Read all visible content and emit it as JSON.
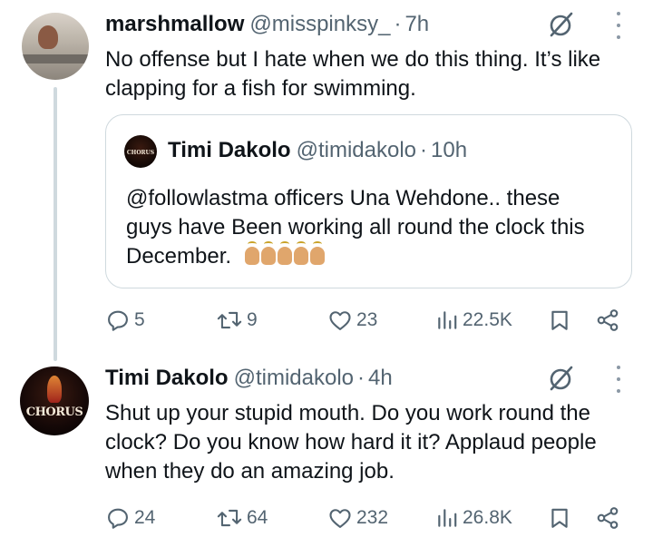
{
  "post1": {
    "display_name": "marshmallow",
    "handle": "@misspinksy_",
    "separator": "·",
    "time": "7h",
    "text_line1": "No offense but I hate when we do this thing. It’s like",
    "text_line2": "clapping for a fish for swimming.",
    "quote": {
      "display_name": "Timi Dakolo",
      "handle": "@timidakolo",
      "separator": "·",
      "time": "10h",
      "avatar_text": "CHORUS",
      "text_line1": "@followlastma officers Una Wehdone.. these",
      "text_line2": "guys have Been working all round the clock this",
      "text_line3": "December."
    },
    "actions": {
      "replies": "5",
      "reposts": "9",
      "likes": "23",
      "views": "22.5K"
    }
  },
  "post2": {
    "display_name": "Timi Dakolo",
    "handle": "@timidakolo",
    "separator": "·",
    "time": "4h",
    "avatar_text": "CHORUS",
    "text_line1": "Shut  up your stupid mouth. Do you work round the",
    "text_line2": "clock? Do you know how hard it it? Applaud people",
    "text_line3": "when they do an amazing job.",
    "actions": {
      "replies": "24",
      "reposts": "64",
      "likes": "232",
      "views": "26.8K"
    }
  },
  "icons": {
    "reply": "reply-icon",
    "repost": "repost-icon",
    "like": "heart-icon",
    "views": "views-icon",
    "bookmark": "bookmark-icon",
    "share": "share-icon",
    "grok": "grok-icon",
    "more": "more-icon"
  },
  "colors": {
    "text": "#0f1419",
    "secondary": "#536471",
    "border": "#cfd9de"
  }
}
